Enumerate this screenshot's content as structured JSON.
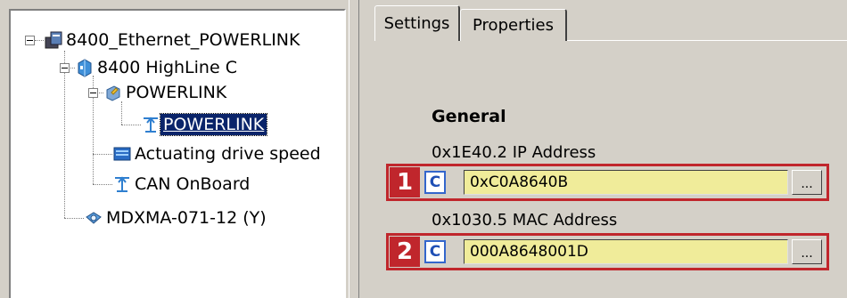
{
  "tree": {
    "root": "8400_Ethernet_POWERLINK",
    "controller": "8400 HighLine C",
    "powerlink_group": "POWERLINK",
    "powerlink_selected": "POWERLINK",
    "actuating": "Actuating drive speed",
    "can": "CAN OnBoard",
    "motor": "MDXMA-071-12 (Y)"
  },
  "tabs": {
    "settings": "Settings",
    "properties": "Properties"
  },
  "section": {
    "title": "General"
  },
  "params": [
    {
      "badge": "1",
      "label": "0x1E40.2 IP Address",
      "mode": "C",
      "value": "0xC0A8640B",
      "button": "..."
    },
    {
      "badge": "2",
      "label": "0x1030.5 MAC Address",
      "mode": "C",
      "value": "000A8648001D",
      "button": "..."
    }
  ],
  "colors": {
    "highlight": "#c0262c",
    "field_bg": "#f0ec9a",
    "selection": "#0a246a"
  }
}
